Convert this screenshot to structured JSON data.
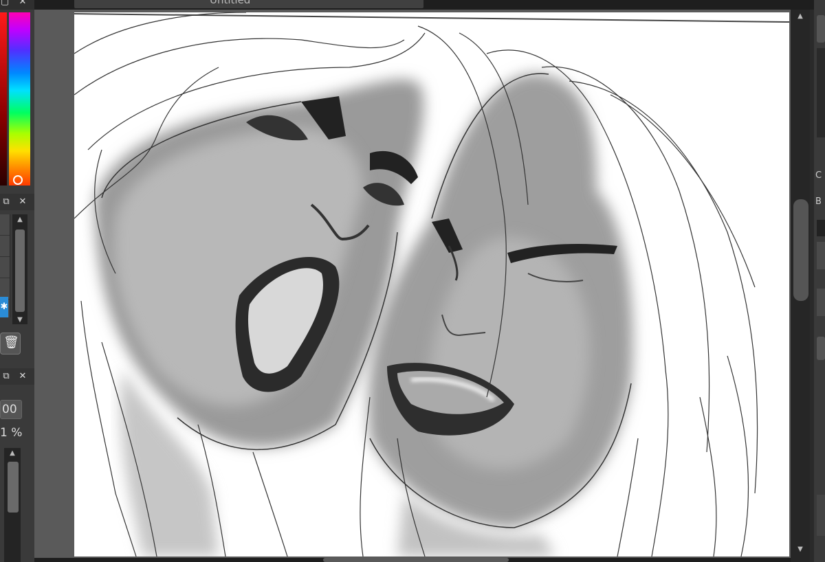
{
  "document": {
    "title": "Untitled"
  },
  "left_panel": {
    "size_value": "00",
    "opacity_value": "1 %"
  },
  "right_panel": {
    "fragments": [
      "C",
      "B"
    ]
  },
  "colors": {
    "accent_selected": "#2b8cd6",
    "panel_bg": "#3a3a3a",
    "canvas_bg": "#ffffff"
  },
  "icons": [
    "float-icon",
    "close-icon",
    "trash-icon",
    "gear-icon",
    "scroll-up-icon",
    "scroll-down-icon"
  ]
}
